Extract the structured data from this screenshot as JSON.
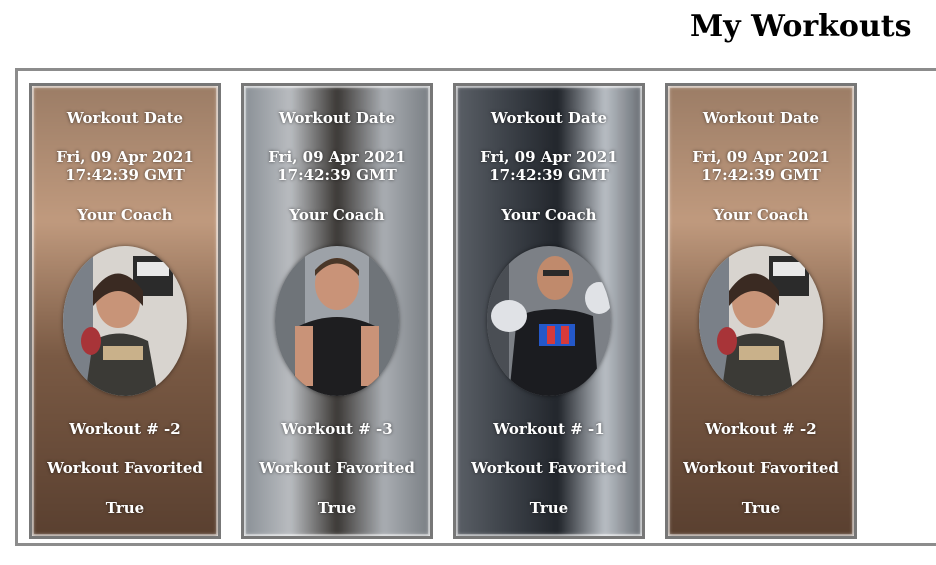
{
  "page": {
    "title": "My Workouts"
  },
  "cards": [
    {
      "date_label": "Workout Date",
      "date_value": "Fri, 09 Apr 2021 17:42:39 GMT",
      "coach_label": "Your Coach",
      "workout_number": "Workout # -2",
      "favorited_label": "Workout Favorited",
      "favorited_value": "True",
      "colors": {
        "bg_top": "#b08a6e",
        "bg_bottom": "#6b4a35",
        "accent": "#c94a3c"
      }
    },
    {
      "date_label": "Workout Date",
      "date_value": "Fri, 09 Apr 2021 17:42:39 GMT",
      "coach_label": "Your Coach",
      "workout_number": "Workout # -3",
      "favorited_label": "Workout Favorited",
      "favorited_value": "True",
      "colors": {
        "bg_top": "#9aa0a6",
        "bg_bottom": "#3d3a38",
        "accent": "#c9a08a"
      }
    },
    {
      "date_label": "Workout Date",
      "date_value": "Fri, 09 Apr 2021 17:42:39 GMT",
      "coach_label": "Your Coach",
      "workout_number": "Workout # -1",
      "favorited_label": "Workout Favorited",
      "favorited_value": "True",
      "colors": {
        "bg_top": "#5b5f63",
        "bg_bottom": "#1e2126",
        "accent": "#d9d9d9"
      }
    },
    {
      "date_label": "Workout Date",
      "date_value": "Fri, 09 Apr 2021 17:42:39 GMT",
      "coach_label": "Your Coach",
      "workout_number": "Workout # -2",
      "favorited_label": "Workout Favorited",
      "favorited_value": "True",
      "colors": {
        "bg_top": "#b08a6e",
        "bg_bottom": "#6b4a35",
        "accent": "#c94a3c"
      }
    }
  ]
}
